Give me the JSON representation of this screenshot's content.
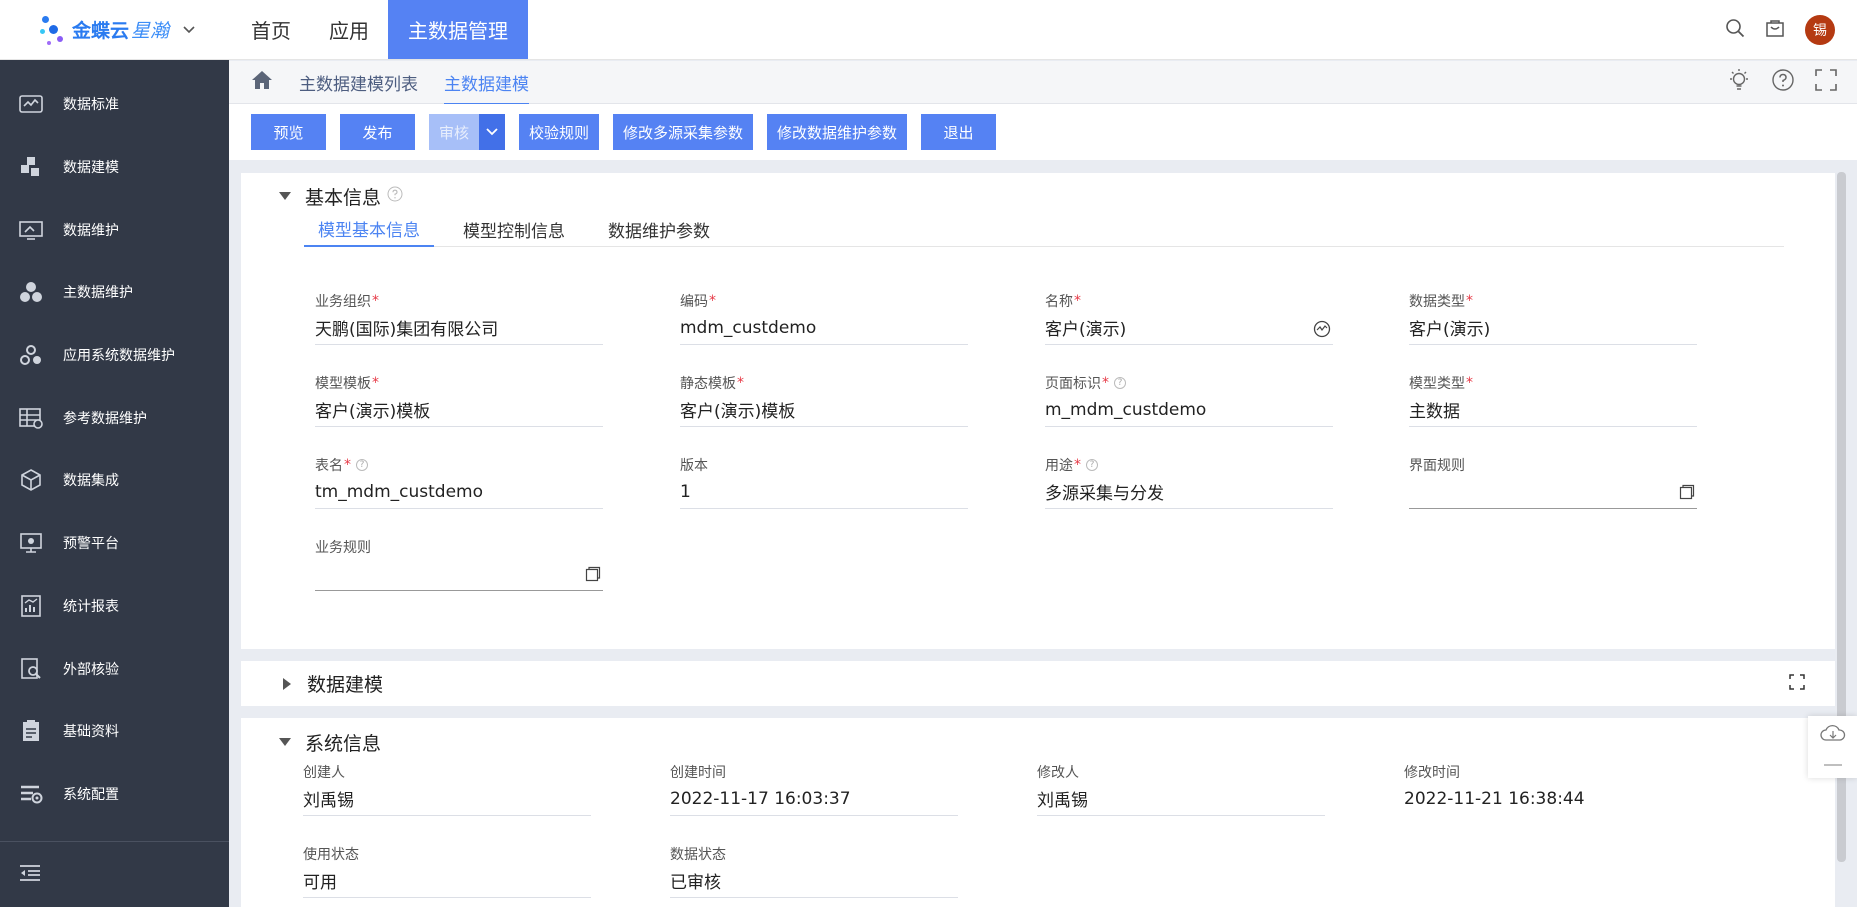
{
  "brand": {
    "name": "金蝶云",
    "name_sub": "星瀚"
  },
  "topnav": {
    "items": [
      "首页",
      "应用",
      "主数据管理"
    ],
    "active_index": 2
  },
  "user": {
    "avatar_text": "锡"
  },
  "sidebar": {
    "items": [
      {
        "label": "数据标准",
        "icon": "data-standard-icon"
      },
      {
        "label": "数据建模",
        "icon": "data-modeling-icon"
      },
      {
        "label": "数据维护",
        "icon": "data-maintenance-icon"
      },
      {
        "label": "主数据维护",
        "icon": "master-data-icon"
      },
      {
        "label": "应用系统数据维护",
        "icon": "app-system-icon"
      },
      {
        "label": "参考数据维护",
        "icon": "reference-data-icon"
      },
      {
        "label": "数据集成",
        "icon": "data-integration-icon"
      },
      {
        "label": "预警平台",
        "icon": "alert-platform-icon"
      },
      {
        "label": "统计报表",
        "icon": "report-icon"
      },
      {
        "label": "外部核验",
        "icon": "external-verify-icon"
      },
      {
        "label": "基础资料",
        "icon": "basic-data-icon"
      },
      {
        "label": "系统配置",
        "icon": "system-config-icon"
      }
    ]
  },
  "breadcrumb": {
    "items": [
      "主数据建模列表",
      "主数据建模"
    ]
  },
  "toolbar": {
    "preview": "预览",
    "publish": "发布",
    "audit": "审核",
    "validate_rules": "校验规则",
    "edit_multi_source": "修改多源采集参数",
    "edit_maintenance": "修改数据维护参数",
    "exit": "退出"
  },
  "basic_info": {
    "title": "基本信息",
    "tabs": [
      "模型基本信息",
      "模型控制信息",
      "数据维护参数"
    ],
    "fields": {
      "org": {
        "label": "业务组织",
        "value": "天鹏(国际)集团有限公司"
      },
      "code": {
        "label": "编码",
        "value": "mdm_custdemo"
      },
      "name": {
        "label": "名称",
        "value": "客户(演示)"
      },
      "data_type": {
        "label": "数据类型",
        "value": "客户(演示)"
      },
      "model_template": {
        "label": "模型模板",
        "value": "客户(演示)模板"
      },
      "static_template": {
        "label": "静态模板",
        "value": "客户(演示)模板"
      },
      "page_id": {
        "label": "页面标识",
        "value": "m_mdm_custdemo"
      },
      "model_type": {
        "label": "模型类型",
        "value": "主数据"
      },
      "table_name": {
        "label": "表名",
        "value": "tm_mdm_custdemo"
      },
      "version": {
        "label": "版本",
        "value": "1"
      },
      "purpose": {
        "label": "用途",
        "value": "多源采集与分发"
      },
      "ui_rules": {
        "label": "界面规则",
        "value": ""
      },
      "biz_rules": {
        "label": "业务规则",
        "value": ""
      }
    }
  },
  "data_modeling": {
    "title": "数据建模"
  },
  "system_info": {
    "title": "系统信息",
    "fields": {
      "creator": {
        "label": "创建人",
        "value": "刘禹锡"
      },
      "created_at": {
        "label": "创建时间",
        "value": "2022-11-17 16:03:37"
      },
      "modifier": {
        "label": "修改人",
        "value": "刘禹锡"
      },
      "modified_at": {
        "label": "修改时间",
        "value": "2022-11-21 16:38:44"
      },
      "use_status": {
        "label": "使用状态",
        "value": "可用"
      },
      "data_status": {
        "label": "数据状态",
        "value": "已审核"
      }
    }
  },
  "colors": {
    "primary": "#5582f3",
    "sidebar_bg": "#323947",
    "avatar": "#b53a12",
    "required": "#e63946"
  }
}
